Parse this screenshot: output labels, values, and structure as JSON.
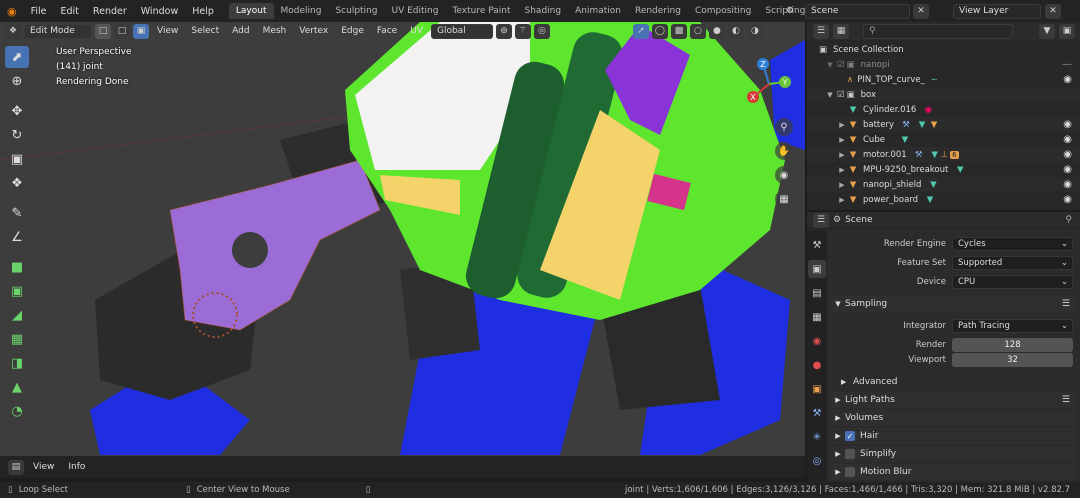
{
  "topbar": {
    "menus": [
      "File",
      "Edit",
      "Render",
      "Window",
      "Help"
    ],
    "workspaces": [
      "Layout",
      "Modeling",
      "Sculpting",
      "UV Editing",
      "Texture Paint",
      "Shading",
      "Animation",
      "Rendering",
      "Compositing",
      "Scripting"
    ],
    "active_workspace": "Layout",
    "add_tab": "+",
    "scene_name": "Scene",
    "view_layer": "View Layer"
  },
  "viewport": {
    "mode": "Edit Mode",
    "menus": [
      "View",
      "Select",
      "Add",
      "Mesh",
      "Vertex",
      "Edge",
      "Face",
      "UV"
    ],
    "orientation": "Global",
    "overlay_lines": [
      "User Perspective",
      "(141) joint",
      "Rendering Done"
    ],
    "gizmo": {
      "x": "X",
      "y": "Y",
      "z": "Z"
    },
    "bottom_menus": [
      "View",
      "Info"
    ]
  },
  "outliner": {
    "search_placeholder": "",
    "items": [
      {
        "label": "Scene Collection",
        "indent": 0,
        "kind": "scene"
      },
      {
        "label": "nanopi",
        "indent": 1,
        "kind": "collection",
        "dim": true
      },
      {
        "label": "PIN_TOP_curve_",
        "indent": 2,
        "kind": "curve"
      },
      {
        "label": "box",
        "indent": 1,
        "kind": "collection"
      },
      {
        "label": "Cylinder.016",
        "indent": 2,
        "kind": "mesh"
      },
      {
        "label": "battery",
        "indent": 2,
        "kind": "mesh"
      },
      {
        "label": "Cube",
        "indent": 2,
        "kind": "mesh"
      },
      {
        "label": "motor.001",
        "indent": 2,
        "kind": "mesh",
        "badge": "6"
      },
      {
        "label": "MPU-9250_breakout",
        "indent": 2,
        "kind": "mesh"
      },
      {
        "label": "nanopi_shield",
        "indent": 2,
        "kind": "mesh"
      },
      {
        "label": "power_board",
        "indent": 2,
        "kind": "mesh"
      }
    ]
  },
  "properties": {
    "context": "Scene",
    "render_engine_label": "Render Engine",
    "render_engine": "Cycles",
    "feature_set_label": "Feature Set",
    "feature_set": "Supported",
    "device_label": "Device",
    "device": "CPU",
    "sampling_label": "Sampling",
    "integrator_label": "Integrator",
    "integrator": "Path Tracing",
    "render_label": "Render",
    "render_samples": "128",
    "viewport_label": "Viewport",
    "viewport_samples": "32",
    "advanced_label": "Advanced",
    "panels": [
      "Light Paths",
      "Volumes",
      "Hair",
      "Simplify",
      "Motion Blur"
    ],
    "hair_checked": true
  },
  "status": {
    "left1": "Loop Select",
    "left2": "Center View to Mouse",
    "stats": "joint | Verts:1,606/1,606 | Edges:3,126/3,126 | Faces:1,466/1,466 | Tris:3,320 | Mem: 321.8 MiB | v2.82.7"
  },
  "colors": {
    "accent": "#4772b3",
    "green": "#5ee62e",
    "purple": "#9b6bd6",
    "blue": "#1f2ee0",
    "yellow": "#f5d36b"
  }
}
